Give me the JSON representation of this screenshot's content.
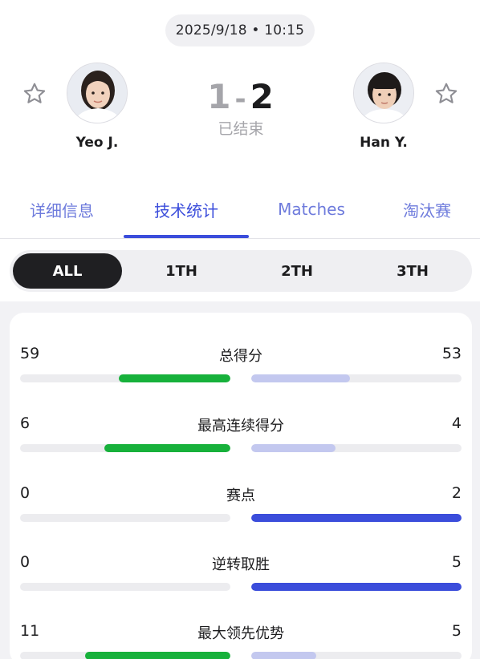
{
  "match": {
    "datetime": "2025/9/18 • 10:15",
    "score_left": "1",
    "score_sep": "-",
    "score_right": "2",
    "status": "已结束"
  },
  "players": {
    "left": {
      "name": "Yeo J.",
      "avatar": "player-photo"
    },
    "right": {
      "name": "Han Y.",
      "avatar": "player-photo"
    }
  },
  "tabs": [
    {
      "label": "详细信息",
      "active": false
    },
    {
      "label": "技术统计",
      "active": true
    },
    {
      "label": "Matches",
      "active": false
    },
    {
      "label": "淘汰赛",
      "active": false
    }
  ],
  "periods": [
    {
      "label": "ALL",
      "active": true
    },
    {
      "label": "1TH",
      "active": false
    },
    {
      "label": "2TH",
      "active": false
    },
    {
      "label": "3TH",
      "active": false
    }
  ],
  "colors": {
    "accent": "#3b4ddb",
    "left_bar": "#17b13b",
    "right_bar_strong": "#3b4ddb",
    "right_bar_weak": "#c3c8ef",
    "track": "#ececef"
  },
  "stats": [
    {
      "label": "总得分",
      "left": "59",
      "right": "53",
      "left_frac": 0.53,
      "right_frac": 0.47,
      "right_strong": false
    },
    {
      "label": "最高连续得分",
      "left": "6",
      "right": "4",
      "left_frac": 0.6,
      "right_frac": 0.4,
      "right_strong": false
    },
    {
      "label": "赛点",
      "left": "0",
      "right": "2",
      "left_frac": 0.0,
      "right_frac": 1.0,
      "right_strong": true
    },
    {
      "label": "逆转取胜",
      "left": "0",
      "right": "5",
      "left_frac": 0.0,
      "right_frac": 1.0,
      "right_strong": true
    },
    {
      "label": "最大领先优势",
      "left": "11",
      "right": "5",
      "left_frac": 0.69,
      "right_frac": 0.31,
      "right_strong": false
    }
  ]
}
